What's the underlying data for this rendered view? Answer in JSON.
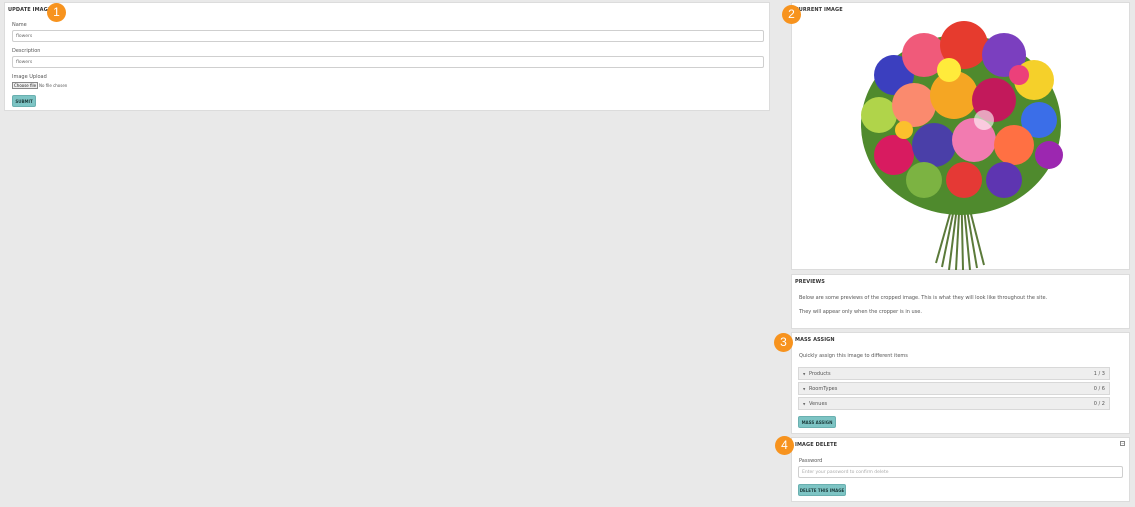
{
  "update": {
    "title": "UPDATE IMAGE",
    "name_label": "Name",
    "name_value": "flowers",
    "desc_label": "Description",
    "desc_value": "flowers",
    "upload_label": "Image Upload",
    "choose_label": "Choose file",
    "no_file": "No file chosen",
    "submit_label": "SUBMIT"
  },
  "current": {
    "title": "CURRENT IMAGE"
  },
  "previews": {
    "title": "PREVIEWS",
    "line1": "Below are some previews of the cropped image. This is what they will look like throughout the site.",
    "line2": "They will appear only when the cropper is in use."
  },
  "mass": {
    "title": "MASS ASSIGN",
    "intro": "Quickly assign this image to different items",
    "items": [
      {
        "name": "Products",
        "count": "1 / 3"
      },
      {
        "name": "RoomTypes",
        "count": "0 / 6"
      },
      {
        "name": "Venues",
        "count": "0 / 2"
      }
    ],
    "button_label": "MASS ASSIGN"
  },
  "delete": {
    "title": "IMAGE DELETE",
    "password_label": "Password",
    "password_placeholder": "Enter your password to confirm delete",
    "button_label": "DELETE THIS IMAGE"
  },
  "badges": [
    "1",
    "2",
    "3",
    "4"
  ],
  "icons": {
    "caret": "caret-down-icon",
    "minimize": "minimize-icon"
  },
  "colors": {
    "accent_button": "#7dc4c4",
    "badge": "#f7931e",
    "background": "#e9e9e9"
  }
}
